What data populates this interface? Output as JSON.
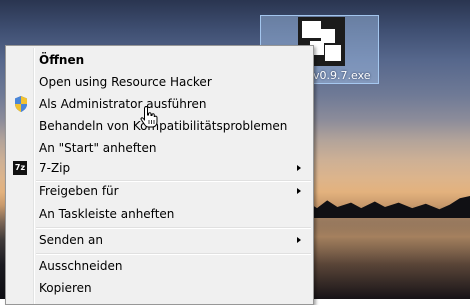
{
  "desktop": {
    "icon": {
      "label": "v0.9.7.exe"
    }
  },
  "context_menu": {
    "items": [
      {
        "label": "Öffnen",
        "bold": true
      },
      {
        "label": "Open using Resource Hacker"
      },
      {
        "label": "Als Administrator ausführen",
        "icon": "uac-shield-icon"
      },
      {
        "label": "Behandeln von Kompatibilitätsproblemen"
      },
      {
        "label": "An \"Start\" anheften"
      },
      {
        "label": "7-Zip",
        "icon": "7zip-icon",
        "icon_text": "7z",
        "submenu": true
      },
      {
        "label": "Freigeben für",
        "submenu": true
      },
      {
        "label": "An Taskleiste anheften"
      },
      {
        "label": "Senden an",
        "submenu": true
      },
      {
        "label": "Ausschneiden"
      },
      {
        "label": "Kopieren"
      }
    ]
  },
  "colors": {
    "menu_background": "#f0f0f0",
    "selection_highlight": "#a8c8f0"
  }
}
